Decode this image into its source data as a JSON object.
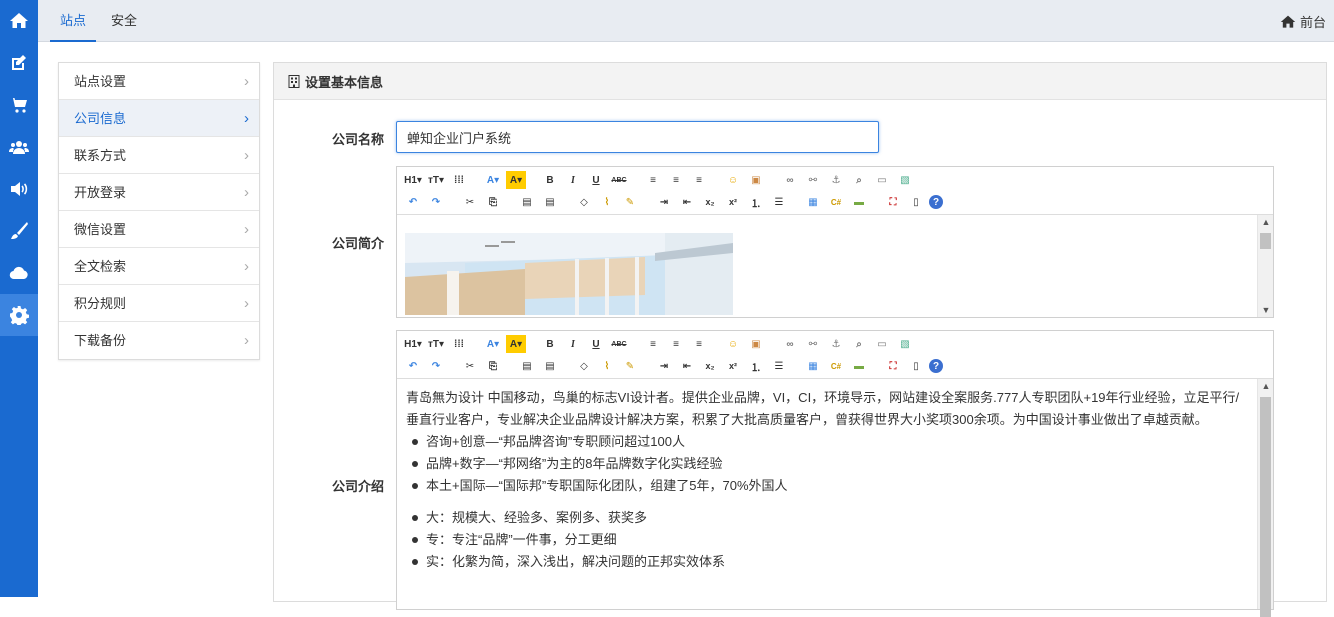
{
  "topbar": {
    "tabs": [
      {
        "label": "站点",
        "active": true
      },
      {
        "label": "安全",
        "active": false
      }
    ],
    "front_label": "前台"
  },
  "rail": {
    "icons": [
      "home-icon",
      "edit-icon",
      "cart-icon",
      "users-icon",
      "volume-icon",
      "brush-icon",
      "cloud-icon",
      "gear-icon"
    ],
    "active": "gear-icon",
    "color": "#1a6ad0"
  },
  "menu": {
    "items": [
      {
        "label": "站点设置",
        "active": false
      },
      {
        "label": "公司信息",
        "active": true
      },
      {
        "label": "联系方式",
        "active": false
      },
      {
        "label": "开放登录",
        "active": false
      },
      {
        "label": "微信设置",
        "active": false
      },
      {
        "label": "全文检索",
        "active": false
      },
      {
        "label": "积分规则",
        "active": false
      },
      {
        "label": "下载备份",
        "active": false
      }
    ]
  },
  "panel": {
    "title": "设置基本信息",
    "fields": {
      "name_label": "公司名称",
      "name_value": "蝉知企业门户系统",
      "intro_label": "公司简介",
      "desc_label": "公司介绍"
    },
    "toolbar_row1": [
      "H1▾",
      "тT▾",
      "⁞⁞⁞",
      "A▾",
      "A▾",
      "B",
      "I",
      "U",
      "ABC",
      "≡",
      "≡",
      "≡",
      "😊",
      "🖼",
      "🔗",
      "⛓",
      "⚓",
      "🔍",
      "📹",
      "🖼"
    ],
    "toolbar_row2": [
      "↶",
      "↷",
      "✂",
      "⎘",
      "📋",
      "📋",
      "◇",
      "🧹",
      "📝",
      "⇥",
      "⇤",
      "x₂",
      "x²",
      "1≡",
      "•≡",
      "▦",
      "C#",
      "▬",
      "⛶",
      "📄",
      "?"
    ],
    "description": {
      "intro": "青岛無为设计 中国移动，鸟巢的标志VI设计者。提供企业品牌，VI，CI，环境导示，网站建设全案服务.777人专职团队+19年行业经验，立足平行/垂直行业客户，专业解决企业品牌设计解决方案，积累了大批高质量客户，曾获得世界大小奖项300余项。为中国设计事业做出了卓越贡献。",
      "list1": [
        "咨询+创意—“邦品牌咨询”专职顾问超过100人",
        "品牌+数字—“邦网络”为主的8年品牌数字化实践经验",
        "本土+国际—“国际邦”专职国际化团队，组建了5年，70%外国人"
      ],
      "list2": [
        "大：规模大、经验多、案例多、获奖多",
        "专：专注“品牌”一件事，分工更细",
        "实：化繁为简，深入浅出，解决问题的正邦实效体系"
      ]
    }
  }
}
